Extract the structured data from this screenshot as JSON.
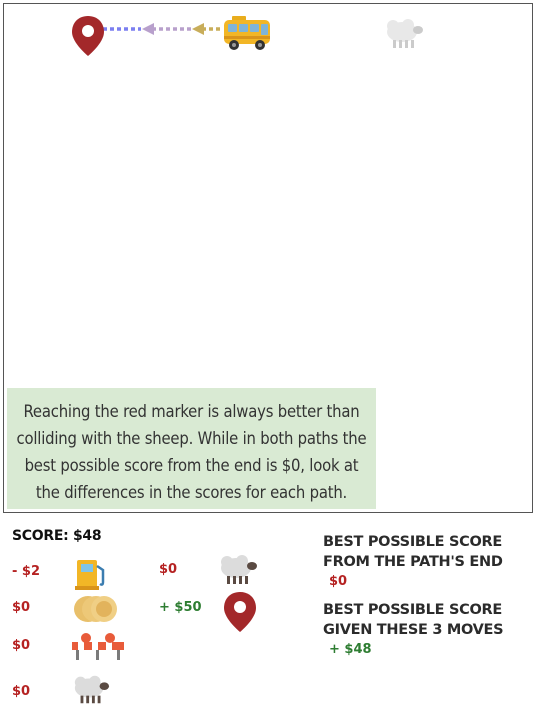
{
  "hint_text": "Reaching the red marker is always better than colliding with the sheep. While in both paths the best possible score from the end is $0, look at the differences in the scores for each path.",
  "score": {
    "label": "SCORE: $48"
  },
  "costs": {
    "fuel": "- $2",
    "coins": "$0",
    "roadblock": "$0",
    "sheep_small": "$0",
    "sheep": "$0",
    "marker": "+ $50"
  },
  "best_from_end": {
    "label_line1": "BEST POSSIBLE SCORE",
    "label_line2": "FROM THE PATH'S END",
    "value": "$0"
  },
  "best_given_moves": {
    "label_line1": "BEST POSSIBLE SCORE",
    "label_line2": "GIVEN THESE 3 MOVES",
    "value": "+ $48"
  },
  "colors": {
    "marker": "#a3282a",
    "bus": "#f2b626",
    "path_blue": "#7b7ff0",
    "path_purple": "#b8a0cc",
    "path_gold": "#c8ad5a",
    "hint_bg": "#d9ead3",
    "negative": "#b52222",
    "positive": "#2e7d32"
  }
}
